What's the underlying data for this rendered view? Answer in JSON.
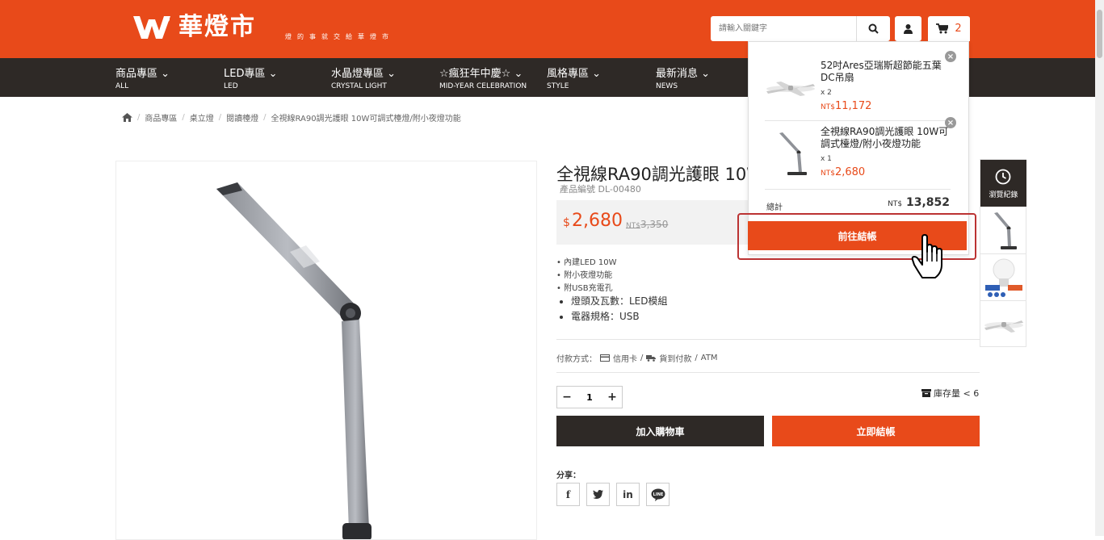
{
  "header": {
    "brand_name": "華燈市",
    "brand_tagline": "燈的事就交給華燈市",
    "search_placeholder": "請輸入關鍵字",
    "cart_count": "2"
  },
  "nav": [
    {
      "label": "商品專區",
      "sub": "ALL"
    },
    {
      "label": "LED專區",
      "sub": "LED"
    },
    {
      "label": "水晶燈專區",
      "sub": "CRYSTAL LIGHT"
    },
    {
      "label": "☆瘋狂年中慶☆",
      "sub": "MID-YEAR CELEBRATION"
    },
    {
      "label": "風格專區",
      "sub": "STYLE"
    },
    {
      "label": "最新消息",
      "sub": "NEWS"
    }
  ],
  "breadcrumb": [
    "商品專區",
    "桌立燈",
    "閱讀檯燈",
    "全視線RA90調光護眼 10W可調式檯燈/附小夜燈功能"
  ],
  "product": {
    "title": "全視線RA90調光護眼 10W可調式檯燈/附小夜燈功能",
    "code": "產品編號 DL-00480",
    "price_symbol": "$",
    "price": "2,680",
    "old_price_prefix": "NT$",
    "old_price": "3,350",
    "features": [
      "• 內建LED 10W",
      "• 附小夜燈功能",
      "• 附USB充電孔"
    ],
    "specs": [
      "燈頭及瓦數：LED模組",
      "電器規格：USB"
    ],
    "payment_label": "付款方式：",
    "payment_card": "信用卡",
    "payment_cod": "貨到付款",
    "payment_atm": "ATM",
    "quantity": "1",
    "stock_text": "庫存量 < 6",
    "add_to_cart": "加入購物車",
    "buy_now": "立即結帳",
    "share_label": "分享："
  },
  "cart_dropdown": {
    "items": [
      {
        "name": "52吋Ares亞瑞斯超節能五葉DC吊扇",
        "qty": "x 2",
        "currency": "NT$",
        "price": "11,172"
      },
      {
        "name": "全視線RA90調光護眼 10W可調式檯燈/附小夜燈功能",
        "qty": "x 1",
        "currency": "NT$",
        "price": "2,680"
      }
    ],
    "total_label": "總計",
    "total_currency": "NT$",
    "total_value": "13,852",
    "checkout_label": "前往結帳"
  },
  "history": {
    "label": "瀏覽紀錄"
  },
  "colors": {
    "brand_orange": "#e84a1a",
    "dark": "#2e2926"
  }
}
